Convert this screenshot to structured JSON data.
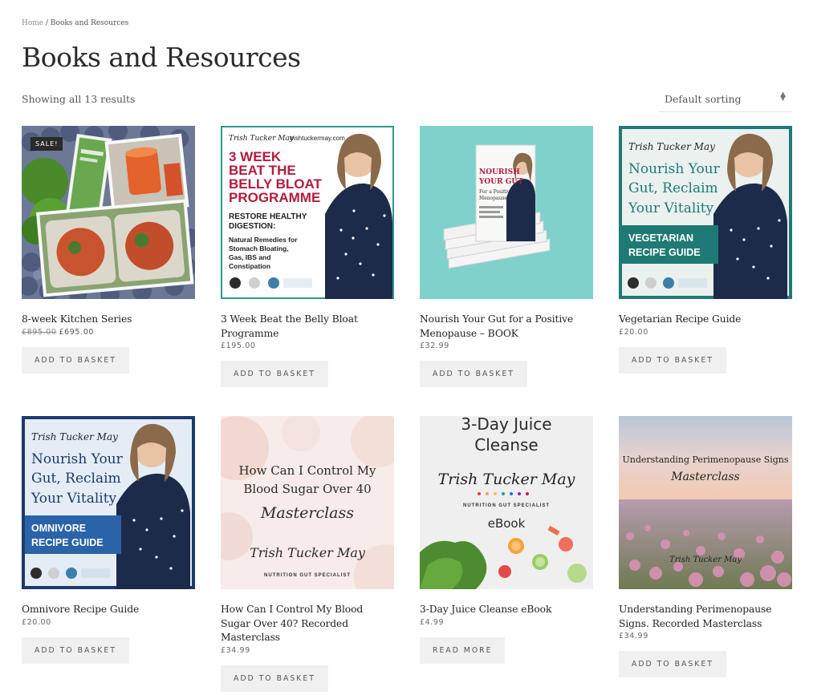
{
  "breadcrumb": {
    "home": "Home",
    "separator": " / ",
    "current": "Books and Resources"
  },
  "page_title": "Books and Resources",
  "result_count": "Showing all 13 results",
  "sorting": {
    "selected": "Default sorting"
  },
  "sale_badge": "SALE!",
  "products": [
    {
      "title": "8-week Kitchen Series",
      "old_price": "£895.00",
      "price": "£695.00",
      "button": "ADD TO BASKET"
    },
    {
      "title": "3 Week Beat the Belly Bloat Programme",
      "price": "£195.00",
      "button": "ADD TO BASKET"
    },
    {
      "title": "Nourish Your Gut for a Positive Menopause – BOOK",
      "price": "£32.99",
      "button": "ADD TO BASKET"
    },
    {
      "title": "Vegetarian Recipe Guide",
      "price": "£20.00",
      "button": "ADD TO BASKET"
    },
    {
      "title": "Omnivore Recipe Guide",
      "price": "£20.00",
      "button": "ADD TO BASKET"
    },
    {
      "title": "How Can I Control My Blood Sugar Over 40? Recorded Masterclass",
      "price": "£34.99",
      "button": "ADD TO BASKET"
    },
    {
      "title": "3-Day Juice Cleanse eBook",
      "price": "£4.99",
      "button": "READ MORE"
    },
    {
      "title": "Understanding Perimenopause Signs. Recorded Masterclass",
      "price": "£34.99",
      "button": "ADD TO BASKET"
    }
  ],
  "image_text": {
    "p2": {
      "brand": "Trish Tucker May",
      "url": "trishtuckermay.com",
      "l1": "3 WEEK",
      "l2": "BEAT THE",
      "l3": "BELLY BLOAT",
      "l4": "PROGRAMME",
      "s1": "RESTORE HEALTHY",
      "s2": "DIGESTION:",
      "d1": "Natural Remedies for",
      "d2": "Stomach Bloating,",
      "d3": "Gas, IBS and",
      "d4": "Constipation"
    },
    "p3": {
      "l1": "NOURISH",
      "l2": "YOUR GUT",
      "l3": "For a Positive",
      "l4": "Menopause"
    },
    "p4": {
      "brand": "Trish Tucker May",
      "h1": "Nourish Your",
      "h2": "Gut, Reclaim",
      "h3": "Your Vitality",
      "b1": "VEGETARIAN",
      "b2": "RECIPE GUIDE"
    },
    "p5": {
      "brand": "Trish Tucker May",
      "h1": "Nourish Your",
      "h2": "Gut, Reclaim",
      "h3": "Your Vitality",
      "b1": "OMNIVORE",
      "b2": "RECIPE GUIDE"
    },
    "p6": {
      "l1": "How Can I Control My",
      "l2": "Blood Sugar Over 40",
      "l3": "Masterclass",
      "brand": "Trish Tucker May",
      "tag": "NUTRITION GUT SPECIALIST"
    },
    "p7": {
      "l1": "3-Day Juice",
      "l2": "Cleanse",
      "brand": "Trish Tucker May",
      "tag": "NUTRITION GUT SPECIALIST",
      "l3": "eBook"
    },
    "p8": {
      "l1": "Understanding Perimenopause Signs",
      "l2": "Masterclass",
      "brand": "Trish Tucker May"
    }
  },
  "colors": {
    "navy": "#1d3a6e",
    "crimson": "#b31c3e",
    "teal": "#1f7a76",
    "mint": "#7fd1cc",
    "button_bg": "#f0f0f0"
  }
}
